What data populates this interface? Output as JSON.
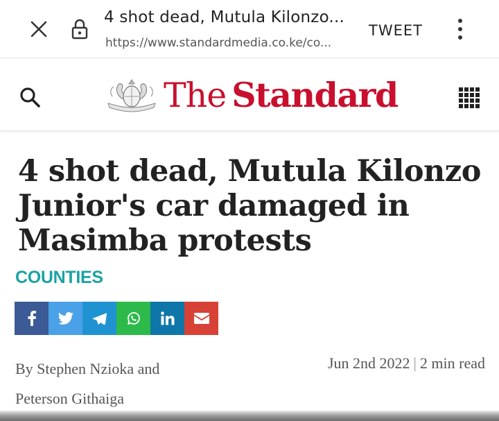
{
  "browser": {
    "page_title": "4 shot dead, Mutula Kilonzo...",
    "url": "https://www.standardmedia.co.ke/co...",
    "tweet_label": "TWEET",
    "icons": [
      "close-icon",
      "lock-icon",
      "more-vert-icon"
    ]
  },
  "header": {
    "logo_the": "The",
    "logo_standard": "Standard",
    "brand_color": "#c8102e",
    "icons": [
      "search-icon",
      "crest-logo",
      "apps-grid-icon"
    ]
  },
  "article": {
    "headline": "4 shot dead, Mutula Kilonzo Junior's car damaged in Masimba protests",
    "category": "COUNTIES",
    "category_color": "#1aa3a3",
    "byline": "By Stephen Nzioka and Peterson Githaiga",
    "date": "Jun 2nd 2022",
    "separator": "|",
    "read_time": "2 min read"
  },
  "share_buttons": [
    {
      "name": "facebook",
      "color": "#3b5a96"
    },
    {
      "name": "twitter",
      "color": "#4aa1e8"
    },
    {
      "name": "telegram",
      "color": "#1f93d2"
    },
    {
      "name": "whatsapp",
      "color": "#2dba4a"
    },
    {
      "name": "linkedin",
      "color": "#0e76a8"
    },
    {
      "name": "email",
      "color": "#d84236"
    }
  ]
}
